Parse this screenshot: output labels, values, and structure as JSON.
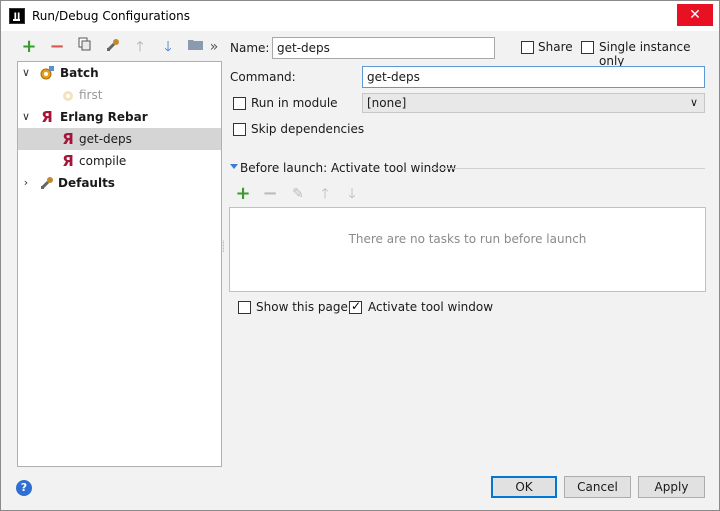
{
  "window": {
    "title": "Run/Debug Configurations",
    "app_icon": "intellij-icon",
    "close_glyph": "✕"
  },
  "toolbar": {
    "icons": [
      "add-icon",
      "remove-icon",
      "copy-icon",
      "wrench-icon",
      "move-up-icon",
      "move-down-icon",
      "folder-icon",
      "more-icon"
    ],
    "more_glyph": "»"
  },
  "tree": {
    "items": [
      {
        "label": "Batch",
        "level": 0,
        "expanded": true,
        "bold": true
      },
      {
        "label": "first",
        "level": 1,
        "disabled": true
      },
      {
        "label": "Erlang Rebar",
        "level": 0,
        "expanded": true,
        "bold": true
      },
      {
        "label": "get-deps",
        "level": 1,
        "selected": true
      },
      {
        "label": "compile",
        "level": 1
      },
      {
        "label": "Defaults",
        "level": 0,
        "expanded": false,
        "bold": true
      }
    ]
  },
  "form": {
    "name_label": "Name:",
    "name_value": "get-deps",
    "share_label": "Share",
    "share_checked": false,
    "single_instance_label": "Single instance only",
    "single_instance_checked": false,
    "command_label": "Command:",
    "command_value": "get-deps",
    "run_in_module_label": "Run in module",
    "run_in_module_checked": false,
    "module_value": "[none]",
    "skip_deps_label": "Skip dependencies",
    "skip_deps_checked": false
  },
  "before_launch": {
    "header": "Before launch: Activate tool window",
    "empty_text": "There are no tasks to run before launch",
    "show_page_label": "Show this page",
    "show_page_checked": false,
    "activate_label": "Activate tool window",
    "activate_checked": true
  },
  "buttons": {
    "ok": "OK",
    "cancel": "Cancel",
    "apply": "Apply",
    "help": "?"
  },
  "colors": {
    "accent": "#0078d7",
    "add_green": "#3a9b2f",
    "remove_red": "#d9534f",
    "rebar_red": "#a3163a"
  }
}
